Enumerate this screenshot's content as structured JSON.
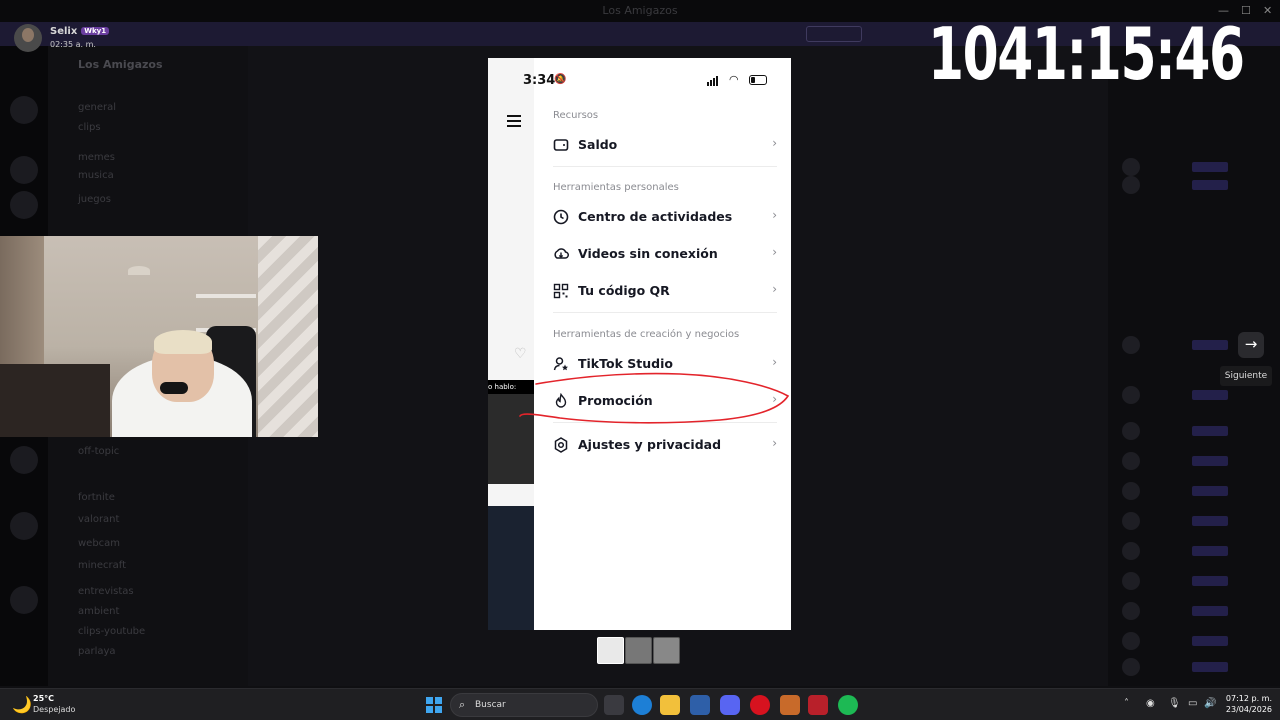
{
  "background": {
    "window_title": "Los Amigazos",
    "server_name": "Los Amigazos",
    "channels": [
      "general",
      "clips",
      "memes",
      "musica",
      "juegos",
      "off-topic",
      "fortnite",
      "valorant",
      "webcam",
      "minecraft",
      "entrevistas",
      "ambient",
      "clips-youtube",
      "parlaya"
    ]
  },
  "profile": {
    "name": "Selix",
    "tag": "Wky1",
    "time": "02:35 a. m."
  },
  "timer": "1041:15:46",
  "next_button": {
    "tooltip": "Siguiente"
  },
  "phone": {
    "status": {
      "time": "3:34"
    },
    "left": {
      "hablo_text": "o hablo:"
    },
    "sections": [
      {
        "title": "Recursos",
        "items": [
          {
            "label": "Saldo",
            "icon": "wallet-icon"
          }
        ]
      },
      {
        "title": "Herramientas personales",
        "items": [
          {
            "label": "Centro de actividades",
            "icon": "clock-icon"
          },
          {
            "label": "Videos sin conexión",
            "icon": "download-icon"
          },
          {
            "label": "Tu código QR",
            "icon": "qr-icon"
          }
        ]
      },
      {
        "title": "Herramientas de creación y negocios",
        "items": [
          {
            "label": "TikTok Studio",
            "icon": "person-star-icon"
          },
          {
            "label": "Promoción",
            "icon": "flame-icon"
          }
        ]
      },
      {
        "title": "",
        "items": [
          {
            "label": "Ajustes y privacidad",
            "icon": "gear-icon"
          }
        ]
      }
    ]
  },
  "annotation": {
    "color": "#e3242b",
    "target": "Promoción"
  },
  "taskbar": {
    "weather_temp": "25°C",
    "weather_desc": "Despejado",
    "search_placeholder": "Buscar",
    "clock_time": "07:12 p. m.",
    "clock_date": "23/04/2026"
  }
}
